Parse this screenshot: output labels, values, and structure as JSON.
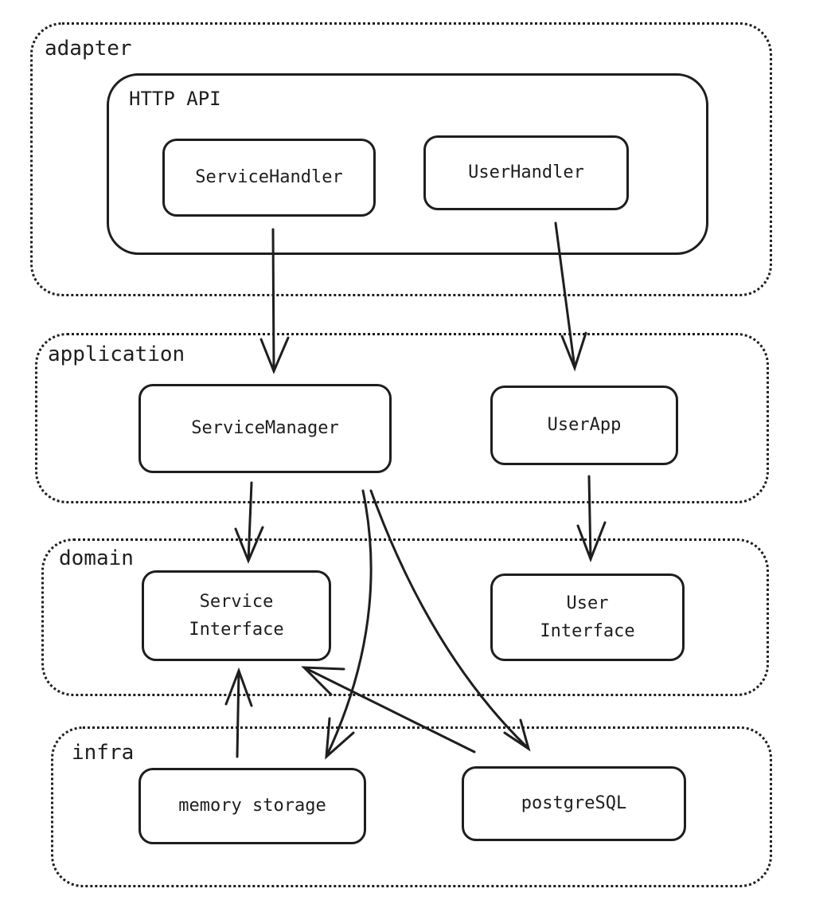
{
  "zones": {
    "adapter": "adapter",
    "application": "application",
    "domain": "domain",
    "infra": "infra"
  },
  "http_api": "HTTP API",
  "nodes": {
    "service_handler": "ServiceHandler",
    "user_handler": "UserHandler",
    "service_manager": "ServiceManager",
    "user_app": "UserApp",
    "service_interface": "Service\nInterface",
    "user_interface": "User\nInterface",
    "memory_storage": "memory storage",
    "postgresql": "postgreSQL"
  }
}
